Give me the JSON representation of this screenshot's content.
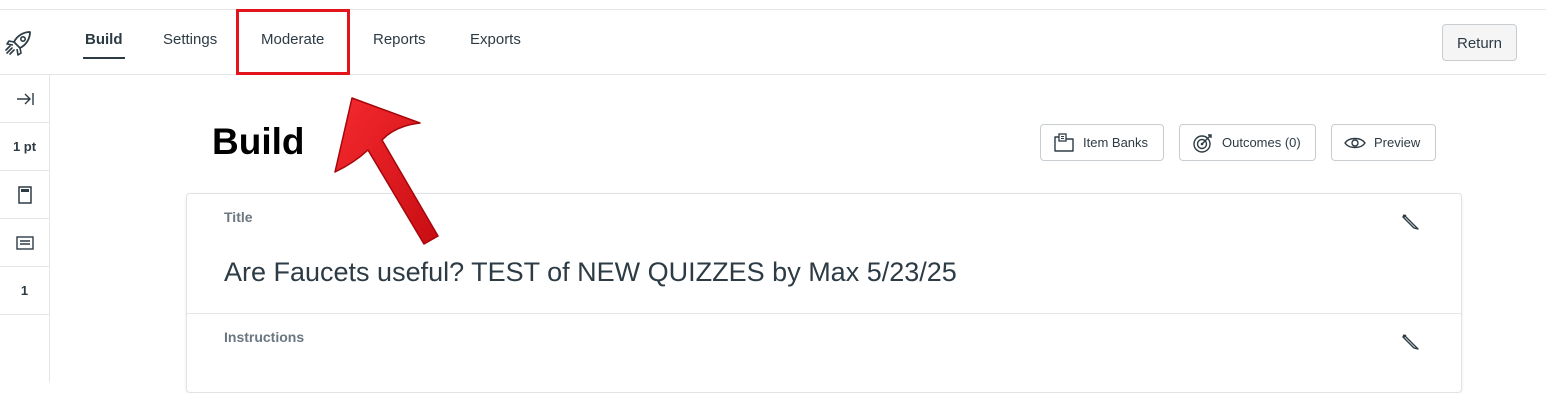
{
  "nav": {
    "tabs": [
      {
        "label": "Build",
        "active": true
      },
      {
        "label": "Settings",
        "active": false
      },
      {
        "label": "Moderate",
        "active": false
      },
      {
        "label": "Reports",
        "active": false
      },
      {
        "label": "Exports",
        "active": false
      }
    ],
    "return_label": "Return"
  },
  "sidebar": {
    "points": "1 pt",
    "count": "1"
  },
  "page": {
    "title": "Build",
    "actions": {
      "item_banks": "Item Banks",
      "outcomes": "Outcomes (0)",
      "preview": "Preview"
    }
  },
  "quiz": {
    "title_label": "Title",
    "title_value": "Are Faucets useful? TEST of NEW QUIZZES by Max 5/23/25",
    "instructions_label": "Instructions"
  },
  "annotation": {
    "highlight_color": "#e3141b",
    "target": "Moderate"
  }
}
